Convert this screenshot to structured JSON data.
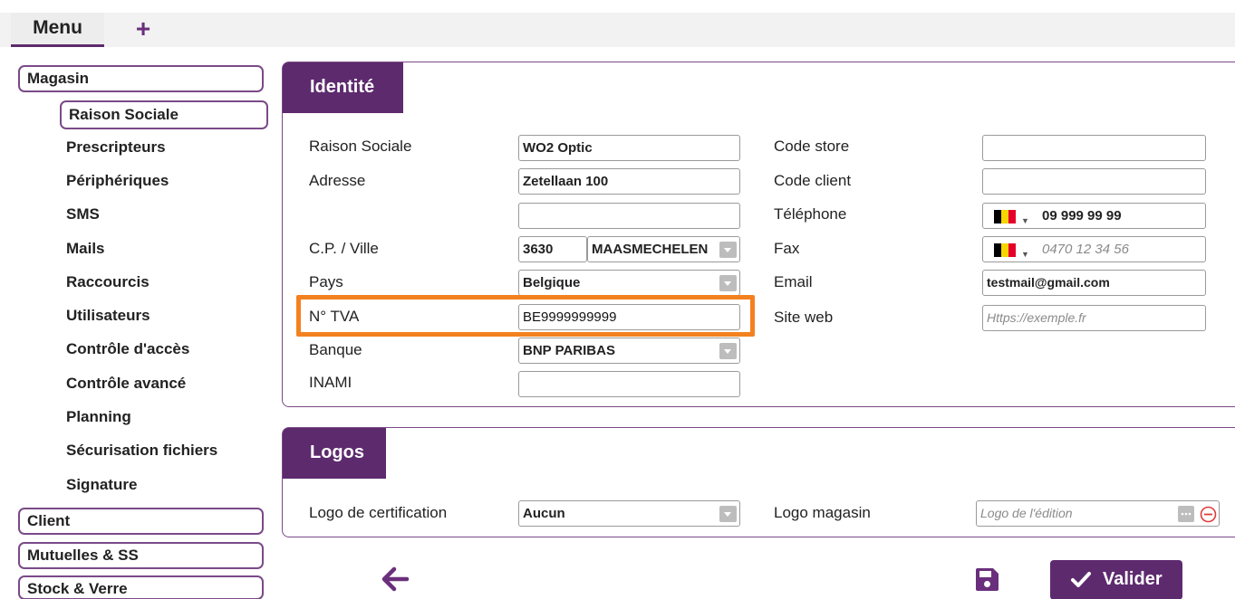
{
  "tabs": {
    "menu": "Menu",
    "add": "+"
  },
  "sidebar": {
    "magasin": "Magasin",
    "items": [
      "Raison Sociale",
      "Prescripteurs",
      "Périphériques",
      "SMS",
      "Mails",
      "Raccourcis",
      "Utilisateurs",
      "Contrôle d'accès",
      "Contrôle avancé",
      "Planning",
      "Sécurisation fichiers",
      "Signature"
    ],
    "client": "Client",
    "mutuelles": "Mutuelles & SS",
    "stock": "Stock & Verre"
  },
  "identite": {
    "title": "Identité",
    "labels": {
      "raison_sociale": "Raison Sociale",
      "adresse": "Adresse",
      "cp_ville": "C.P. / Ville",
      "pays": "Pays",
      "tva": "N° TVA",
      "banque": "Banque",
      "inami": "INAMI",
      "code_store": "Code store",
      "code_client": "Code client",
      "telephone": "Téléphone",
      "fax": "Fax",
      "email": "Email",
      "site_web": "Site web"
    },
    "values": {
      "raison_sociale": "WO2 Optic",
      "adresse": "Zetellaan 100",
      "adresse2": "",
      "cp": "3630",
      "ville": "MAASMECHELEN",
      "pays": "Belgique",
      "tva": "BE9999999999",
      "banque": "BNP PARIBAS",
      "inami": "",
      "code_store": "",
      "code_client": "",
      "telephone": "09 999 99 99",
      "email": "testmail@gmail.com"
    },
    "placeholders": {
      "fax": "0470 12 34 56",
      "site_web": "Https://exemple.fr"
    }
  },
  "logos": {
    "title": "Logos",
    "certif_label": "Logo de certification",
    "certif_value": "Aucun",
    "magasin_label": "Logo magasin",
    "magasin_placeholder": "Logo de l'édition"
  },
  "actions": {
    "valider": "Valider"
  },
  "colors": {
    "brand": "#5e2a6e",
    "highlight": "#f4811f",
    "flag": [
      "#000000",
      "#f6d500",
      "#e4002b"
    ]
  }
}
